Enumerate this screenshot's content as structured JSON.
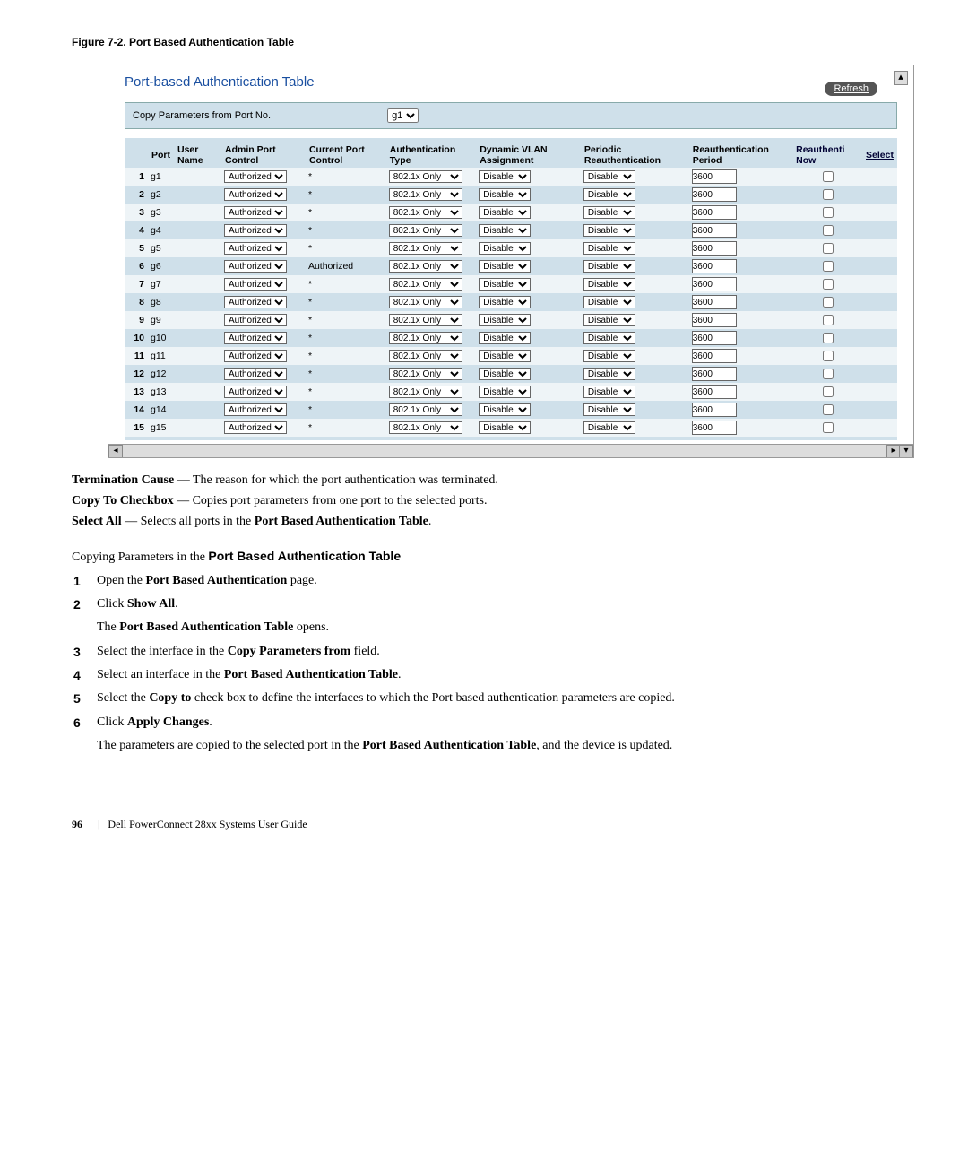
{
  "figure_caption": "Figure 7-2.    Port Based Authentication Table",
  "screenshot": {
    "title": "Port-based Authentication Table",
    "refresh": "Refresh",
    "copy_label": "Copy Parameters from Port No.",
    "copy_select": "g1",
    "headers": {
      "port": "Port",
      "user": "User Name",
      "admin": "Admin Port Control",
      "current": "Current Port Control",
      "auth": "Authentication Type",
      "vlan": "Dynamic VLAN Assignment",
      "periodic": "Periodic Reauthentication",
      "reauth_period": "Reauthentication Period",
      "reauth_now": "Reauthenti Now",
      "select": "Select"
    },
    "rows": [
      {
        "n": "1",
        "port": "g1",
        "admin": "Authorized",
        "cur": "*",
        "auth": "802.1x Only",
        "vlan": "Disable",
        "per": "Disable",
        "rp": "3600"
      },
      {
        "n": "2",
        "port": "g2",
        "admin": "Authorized",
        "cur": "*",
        "auth": "802.1x Only",
        "vlan": "Disable",
        "per": "Disable",
        "rp": "3600"
      },
      {
        "n": "3",
        "port": "g3",
        "admin": "Authorized",
        "cur": "*",
        "auth": "802.1x Only",
        "vlan": "Disable",
        "per": "Disable",
        "rp": "3600"
      },
      {
        "n": "4",
        "port": "g4",
        "admin": "Authorized",
        "cur": "*",
        "auth": "802.1x Only",
        "vlan": "Disable",
        "per": "Disable",
        "rp": "3600"
      },
      {
        "n": "5",
        "port": "g5",
        "admin": "Authorized",
        "cur": "*",
        "auth": "802.1x Only",
        "vlan": "Disable",
        "per": "Disable",
        "rp": "3600"
      },
      {
        "n": "6",
        "port": "g6",
        "admin": "Authorized",
        "cur": "Authorized",
        "auth": "802.1x Only",
        "vlan": "Disable",
        "per": "Disable",
        "rp": "3600"
      },
      {
        "n": "7",
        "port": "g7",
        "admin": "Authorized",
        "cur": "*",
        "auth": "802.1x Only",
        "vlan": "Disable",
        "per": "Disable",
        "rp": "3600"
      },
      {
        "n": "8",
        "port": "g8",
        "admin": "Authorized",
        "cur": "*",
        "auth": "802.1x Only",
        "vlan": "Disable",
        "per": "Disable",
        "rp": "3600"
      },
      {
        "n": "9",
        "port": "g9",
        "admin": "Authorized",
        "cur": "*",
        "auth": "802.1x Only",
        "vlan": "Disable",
        "per": "Disable",
        "rp": "3600"
      },
      {
        "n": "10",
        "port": "g10",
        "admin": "Authorized",
        "cur": "*",
        "auth": "802.1x Only",
        "vlan": "Disable",
        "per": "Disable",
        "rp": "3600"
      },
      {
        "n": "11",
        "port": "g11",
        "admin": "Authorized",
        "cur": "*",
        "auth": "802.1x Only",
        "vlan": "Disable",
        "per": "Disable",
        "rp": "3600"
      },
      {
        "n": "12",
        "port": "g12",
        "admin": "Authorized",
        "cur": "*",
        "auth": "802.1x Only",
        "vlan": "Disable",
        "per": "Disable",
        "rp": "3600"
      },
      {
        "n": "13",
        "port": "g13",
        "admin": "Authorized",
        "cur": "*",
        "auth": "802.1x Only",
        "vlan": "Disable",
        "per": "Disable",
        "rp": "3600"
      },
      {
        "n": "14",
        "port": "g14",
        "admin": "Authorized",
        "cur": "*",
        "auth": "802.1x Only",
        "vlan": "Disable",
        "per": "Disable",
        "rp": "3600"
      },
      {
        "n": "15",
        "port": "g15",
        "admin": "Authorized",
        "cur": "*",
        "auth": "802.1x Only",
        "vlan": "Disable",
        "per": "Disable",
        "rp": "3600"
      }
    ]
  },
  "defs": {
    "term_cause_b": "Termination Cause",
    "term_cause_t": " — The reason for which the port authentication was terminated.",
    "copy_b": "Copy To Checkbox",
    "copy_t": " — Copies port parameters from one port to the selected ports.",
    "select_b": "Select All",
    "select_t1": " — Selects all ports in the ",
    "select_t2": "Port Based Authentication Table",
    "select_t3": "."
  },
  "subhead_pre": "Copying Parameters in the ",
  "subhead_bold": "Port Based Authentication Table",
  "steps": {
    "s1a": "Open the ",
    "s1b": "Port Based Authentication",
    "s1c": " page.",
    "s2a": "Click ",
    "s2b": "Show All",
    "s2c": ".",
    "s2res_a": "The ",
    "s2res_b": "Port Based Authentication Table",
    "s2res_c": " opens.",
    "s3a": "Select the interface in the ",
    "s3b": "Copy Parameters from",
    "s3c": " field.",
    "s4a": "Select an interface in the ",
    "s4b": "Port Based Authentication Table",
    "s4c": ".",
    "s5a": "Select the ",
    "s5b": "Copy to",
    "s5c": " check box to define the interfaces to which the Port based authentication parameters are copied.",
    "s6a": "Click ",
    "s6b": "Apply Changes",
    "s6c": ".",
    "s6res_a": "The parameters are copied to the selected port in the ",
    "s6res_b": "Port Based Authentication Table",
    "s6res_c": ", and the device is updated."
  },
  "footer": {
    "page": "96",
    "guide": "Dell PowerConnect 28xx Systems User Guide"
  }
}
